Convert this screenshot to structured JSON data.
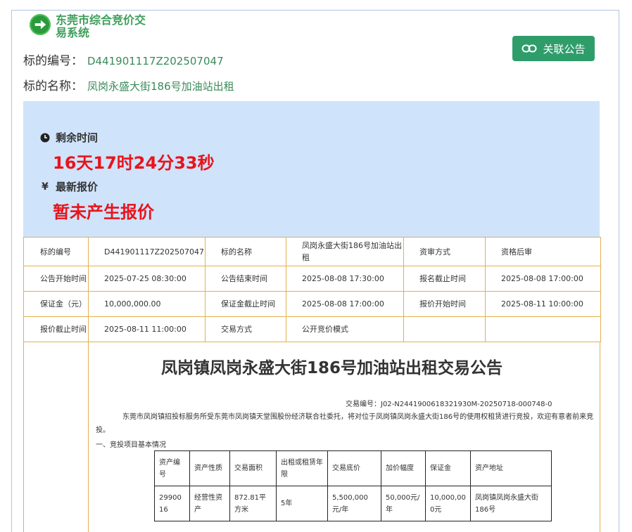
{
  "brand": {
    "title": "东莞市综合竞价交易系统",
    "accent": "#3f9e5b"
  },
  "header": {
    "code_label": "标的编号：",
    "code_value": "D441901117Z202507047",
    "name_label": "标的名称：",
    "name_value": "凤岗永盛大街186号加油站出租",
    "related_button": "关联公告"
  },
  "status": {
    "remaining_label": "剩余时间",
    "remaining_value": "16天17时24分33秒",
    "price_label": "最新报价",
    "price_value": "暂未产生报价",
    "highlight_color": "#e8141b",
    "panel_color": "#cfe3fb"
  },
  "info_table": {
    "rows": [
      [
        "标的编号",
        "D441901117Z202507047",
        "标的名称",
        "凤岗永盛大街186号加油站出租",
        "资审方式",
        "资格后审"
      ],
      [
        "公告开始时间",
        "2025-07-25 08:30:00",
        "公告结束时间",
        "2025-08-08 17:30:00",
        "报名截止时间",
        "2025-08-08 17:00:00"
      ],
      [
        "保证金（元）",
        "10,000,000.00",
        "保证金截止时间",
        "2025-08-08 17:00:00",
        "报价开始时间",
        "2025-08-11 10:00:00"
      ],
      [
        "报价截止时间",
        "2025-08-11 11:00:00",
        "交易方式",
        "公开竞价模式",
        "",
        ""
      ]
    ]
  },
  "notice": {
    "title": "凤岗镇凤岗永盛大街186号加油站出租交易公告",
    "trade_no": "交易编号：J02-N2441900618321930M-20250718-000748-0",
    "paragraph": "东莞市凤岗镇招投标服务所受东莞市凤岗镇天堂围股份经济联合社委托，将对位于凤岗镇凤岗永盛大街186号的使用权租赁进行竞投，欢迎有意者前来竞投。",
    "section_heading": "一、竞投项目基本情况",
    "asset_table": {
      "headers": [
        "资产编号",
        "资产性质",
        "交易面积",
        "出租或租赁年限",
        "交易底价",
        "加价幅度",
        "保证金",
        "资产地址"
      ],
      "row": [
        "2990016",
        "经营性资产",
        "872.81平方米",
        "5年",
        "5,500,000元/年",
        "50,000元/年",
        "10,000,000元",
        "凤岗镇凤岗永盛大街186号"
      ]
    }
  }
}
